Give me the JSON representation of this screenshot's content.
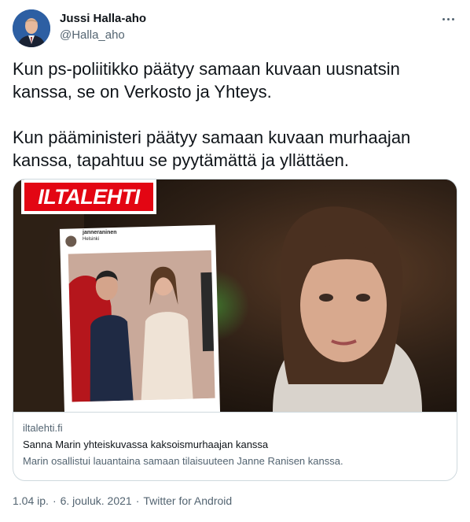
{
  "author": {
    "name": "Jussi Halla-aho",
    "handle": "@Halla_aho",
    "avatar_icon": "profile-photo"
  },
  "more_icon": "ellipsis-icon",
  "tweet": {
    "text": "Kun ps-poliitikko päätyy samaan kuvaan uusnatsin kanssa, se on Verkosto ja Yhteys.\n\nKun pääministeri päätyy samaan kuvaan murhaajan kanssa, tapahtuu se pyytämättä ja yllättäen."
  },
  "card": {
    "image": {
      "publisher_logo": "ILTALEHTI",
      "inset_username": "janneraninen",
      "inset_location": "Helsinki"
    },
    "domain": "iltalehti.fi",
    "title": "Sanna Marin yhteiskuvassa kaksoismurhaajan kanssa",
    "description": "Marin osallistui lauantaina samaan tilaisuuteen Janne Ranisen kanssa."
  },
  "footer": {
    "time": "1.04 ip.",
    "separator": "·",
    "date": "6. jouluk. 2021",
    "separator2": "·",
    "source": "Twitter for Android"
  },
  "colors": {
    "text": "#0f1419",
    "secondary": "#536471",
    "border": "#cfd9de",
    "logo_red": "#e30613"
  }
}
